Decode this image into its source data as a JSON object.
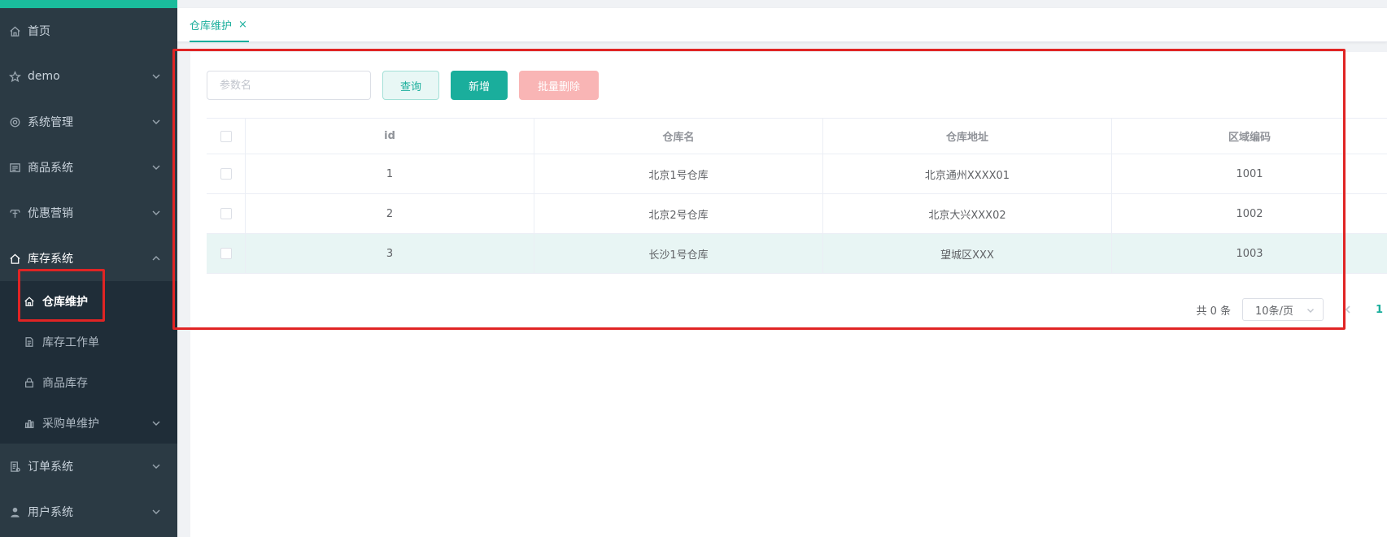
{
  "sidebar": {
    "items": [
      {
        "label": "首页",
        "icon": "home-icon"
      },
      {
        "label": "demo",
        "icon": "star-icon"
      },
      {
        "label": "系统管理",
        "icon": "gear-icon"
      },
      {
        "label": "商品系统",
        "icon": "product-icon"
      },
      {
        "label": "优惠营销",
        "icon": "coupon-icon"
      },
      {
        "label": "库存系统",
        "icon": "home-icon"
      },
      {
        "label": "订单系统",
        "icon": "order-icon"
      },
      {
        "label": "用户系统",
        "icon": "user-icon"
      }
    ],
    "inventory_submenu": [
      {
        "label": "仓库维护",
        "icon": "home-icon"
      },
      {
        "label": "库存工作单",
        "icon": "document-icon"
      },
      {
        "label": "商品库存",
        "icon": "lock-icon"
      },
      {
        "label": "采购单维护",
        "icon": "bar-chart-icon"
      }
    ]
  },
  "tabs": {
    "active": "仓库维护",
    "close": "×"
  },
  "toolbar": {
    "search_placeholder": "参数名",
    "query_label": "查询",
    "add_label": "新增",
    "batch_delete_label": "批量删除"
  },
  "table": {
    "headers": [
      "id",
      "仓库名",
      "仓库地址",
      "区域编码"
    ],
    "rows": [
      [
        "1",
        "北京1号仓库",
        "北京通州XXXX01",
        "1001"
      ],
      [
        "2",
        "北京2号仓库",
        "北京大兴XXX02",
        "1002"
      ],
      [
        "3",
        "长沙1号仓库",
        "望城区XXX",
        "1003"
      ]
    ]
  },
  "pagination": {
    "total": "共 0 条",
    "page_size": "10条/页",
    "current_page": "1"
  },
  "colors": {
    "accent": "#1aae9c",
    "sidebar_bg": "#2b3a44",
    "highlight_box": "#e02424",
    "danger_disabled": "#f9b5b5"
  }
}
